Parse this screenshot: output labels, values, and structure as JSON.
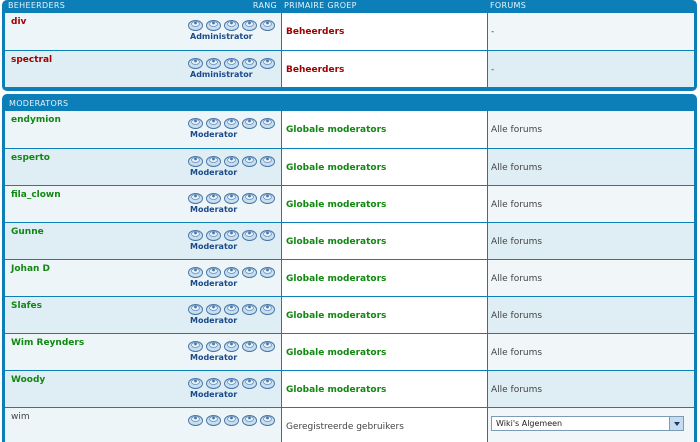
{
  "headers": {
    "user": "BEHEERDERS",
    "rank": "RANG",
    "group": "PRIMAIRE GROEP",
    "forums": "FORUMS"
  },
  "admins": [
    {
      "name": "div",
      "rank": "Administrator",
      "group": "Beheerders",
      "forums": "-"
    },
    {
      "name": "spectral",
      "rank": "Administrator",
      "group": "Beheerders",
      "forums": "-"
    }
  ],
  "moderators_title": "MODERATORS",
  "moderators": [
    {
      "name": "endymion",
      "rank": "Moderator",
      "group": "Globale moderators",
      "forums": "Alle forums"
    },
    {
      "name": "esperto",
      "rank": "Moderator",
      "group": "Globale moderators",
      "forums": "Alle forums"
    },
    {
      "name": "fila_clown",
      "rank": "Moderator",
      "group": "Globale moderators",
      "forums": "Alle forums"
    },
    {
      "name": "Gunne",
      "rank": "Moderator",
      "group": "Globale moderators",
      "forums": "Alle forums"
    },
    {
      "name": "Johan D",
      "rank": "Moderator",
      "group": "Globale moderators",
      "forums": "Alle forums"
    },
    {
      "name": "Slafes",
      "rank": "Moderator",
      "group": "Globale moderators",
      "forums": "Alle forums"
    },
    {
      "name": "Wim Reynders",
      "rank": "Moderator",
      "group": "Globale moderators",
      "forums": "Alle forums"
    },
    {
      "name": "Woody",
      "rank": "Moderator",
      "group": "Globale moderators",
      "forums": "Alle forums"
    }
  ],
  "last_row": {
    "name": "wim",
    "group": "Geregistreerde gebruikers",
    "forums_select": "Wiki's Algemeen"
  },
  "icons": {
    "rank_star": "rank-star-icon"
  },
  "colors": {
    "frame": "#0c7fb9",
    "admin": "#a00000",
    "moderator": "#118811",
    "rank_text": "#1a4a8a"
  }
}
